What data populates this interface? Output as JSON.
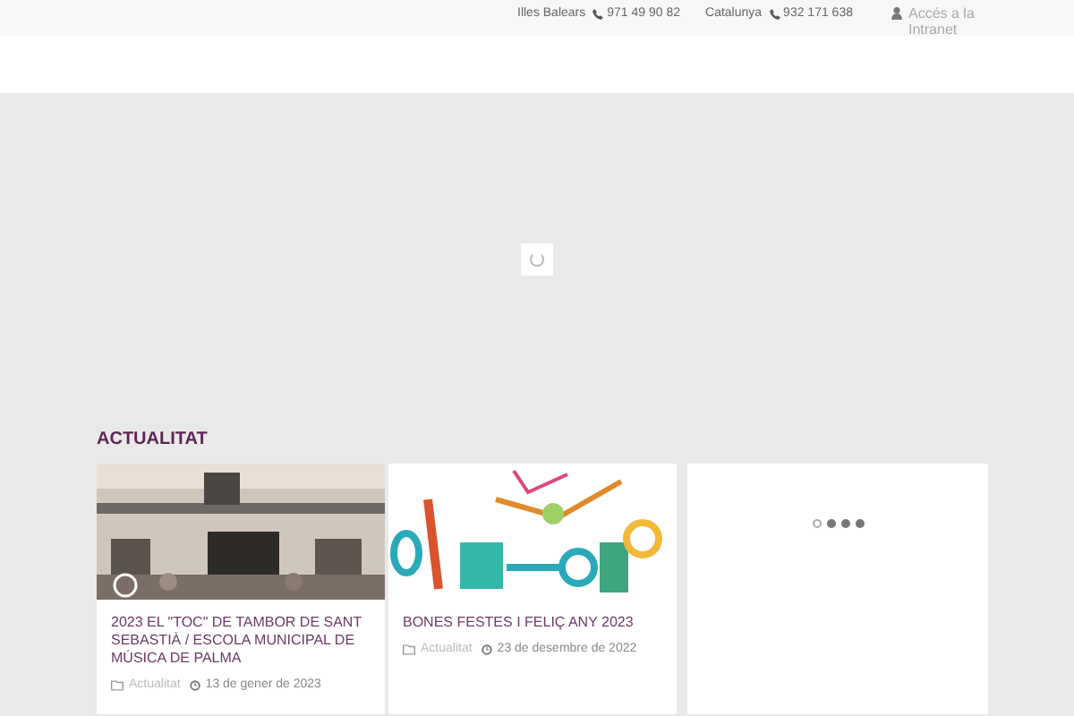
{
  "top_bar": {
    "contacts": [
      {
        "region": "Illes Balears",
        "phone": "971 49 90 82"
      },
      {
        "region": "Catalunya",
        "phone": "932 171 638"
      }
    ],
    "intranet_link": "Accés a la Intranet"
  },
  "section_title": "ACTUALITAT",
  "posts": [
    {
      "title": "2023 EL \"TOC\" DE TAMBOR DE SANT SEBASTIÀ / ESCOLA MUNICIPAL DE MÚSICA DE PALMA",
      "category": "Actualitat",
      "date": "13 de gener de 2023"
    },
    {
      "kind": "illustration",
      "title": "BONES FESTES I FELIÇ ANY 2023",
      "category": "Actualitat",
      "date": "23 de desembre de 2022"
    }
  ],
  "slider_dots": [
    {
      "selected": true
    },
    {
      "selected": false
    },
    {
      "selected": false
    },
    {
      "selected": false
    }
  ]
}
